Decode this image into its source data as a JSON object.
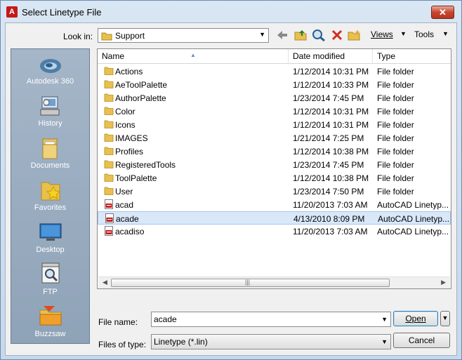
{
  "window": {
    "title": "Select Linetype File",
    "logo_letter": "A",
    "close_glyph": "✕"
  },
  "toolbar": {
    "lookin_label": "Look in:",
    "lookin_value": "Support",
    "views_label": "Views",
    "tools_label": "Tools",
    "icons": [
      "back-arrow-icon",
      "up-folder-icon",
      "search-web-icon",
      "delete-icon",
      "new-folder-icon"
    ]
  },
  "places": [
    {
      "label": "Autodesk 360",
      "icon": "autodesk-360-icon"
    },
    {
      "label": "History",
      "icon": "history-icon"
    },
    {
      "label": "Documents",
      "icon": "documents-icon"
    },
    {
      "label": "Favorites",
      "icon": "favorites-icon"
    },
    {
      "label": "Desktop",
      "icon": "desktop-icon"
    },
    {
      "label": "FTP",
      "icon": "ftp-icon"
    },
    {
      "label": "Buzzsaw",
      "icon": "buzzsaw-icon"
    }
  ],
  "columns": {
    "name": "Name",
    "date": "Date modified",
    "type": "Type"
  },
  "files": [
    {
      "name": "Actions",
      "date": "1/12/2014 10:31 PM",
      "type": "File folder",
      "kind": "folder"
    },
    {
      "name": "AeToolPalette",
      "date": "1/12/2014 10:33 PM",
      "type": "File folder",
      "kind": "folder"
    },
    {
      "name": "AuthorPalette",
      "date": "1/23/2014 7:45 PM",
      "type": "File folder",
      "kind": "folder"
    },
    {
      "name": "Color",
      "date": "1/12/2014 10:31 PM",
      "type": "File folder",
      "kind": "folder"
    },
    {
      "name": "Icons",
      "date": "1/12/2014 10:31 PM",
      "type": "File folder",
      "kind": "folder"
    },
    {
      "name": "IMAGES",
      "date": "1/21/2014 7:25 PM",
      "type": "File folder",
      "kind": "folder"
    },
    {
      "name": "Profiles",
      "date": "1/12/2014 10:38 PM",
      "type": "File folder",
      "kind": "folder"
    },
    {
      "name": "RegisteredTools",
      "date": "1/23/2014 7:45 PM",
      "type": "File folder",
      "kind": "folder"
    },
    {
      "name": "ToolPalette",
      "date": "1/12/2014 10:38 PM",
      "type": "File folder",
      "kind": "folder"
    },
    {
      "name": "User",
      "date": "1/23/2014 7:50 PM",
      "type": "File folder",
      "kind": "folder"
    },
    {
      "name": "acad",
      "date": "11/20/2013 7:03 AM",
      "type": "AutoCAD Linetyp...",
      "kind": "lin"
    },
    {
      "name": "acade",
      "date": "4/13/2010 8:09 PM",
      "type": "AutoCAD Linetyp...",
      "kind": "lin",
      "selected": true
    },
    {
      "name": "acadiso",
      "date": "11/20/2013 7:03 AM",
      "type": "AutoCAD Linetyp...",
      "kind": "lin"
    }
  ],
  "form": {
    "filename_label": "File name:",
    "filename_value": "acade",
    "filetype_label": "Files of type:",
    "filetype_value": "Linetype (*.lin)",
    "open_label": "Open",
    "cancel_label": "Cancel"
  },
  "colors": {
    "accent": "#3c7fb1",
    "selection": "#d9e8f9",
    "places_bg": "#97aabe",
    "close_red": "#c7452f"
  }
}
